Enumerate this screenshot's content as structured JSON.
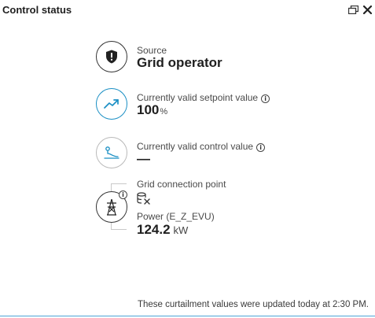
{
  "header": {
    "title": "Control status"
  },
  "source": {
    "label": "Source",
    "value": "Grid operator"
  },
  "setpoint": {
    "label": "Currently valid setpoint value",
    "value": "100",
    "unit": "%"
  },
  "control": {
    "label": "Currently valid control value",
    "value": "—"
  },
  "connection": {
    "label": "Grid connection point",
    "power_label": "Power (E_Z_EVU)",
    "power_value": "124.2",
    "power_unit": "kW"
  },
  "info_glyph": "i",
  "footer": {
    "text": "These curtailment values were updated today at 2:30 PM."
  },
  "colors": {
    "accent": "#1a8fc4",
    "border_gray": "#b9b9b9",
    "bottom_line": "#4fa3d6"
  }
}
